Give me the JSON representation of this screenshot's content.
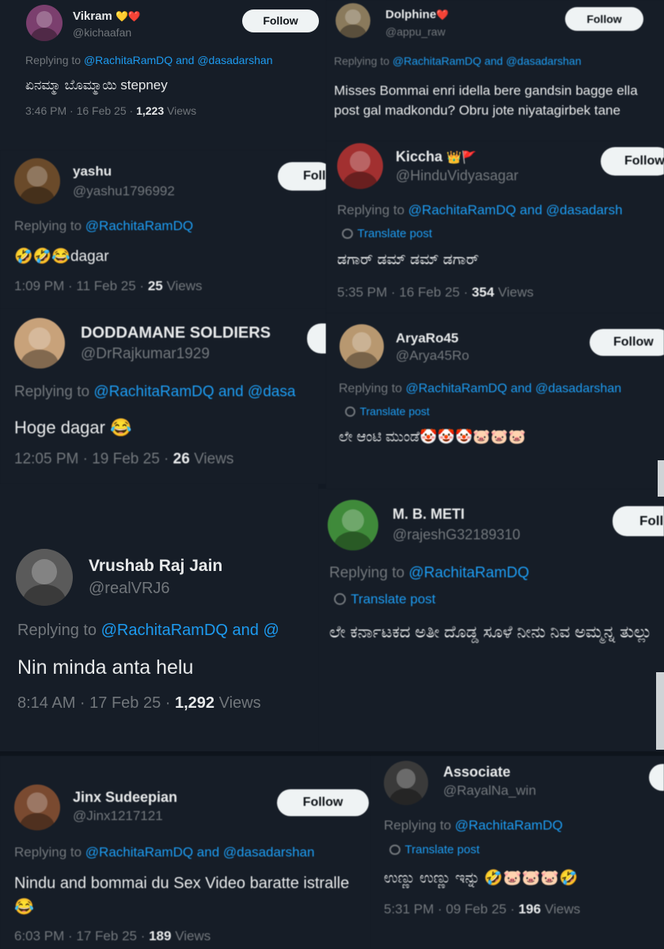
{
  "follow_label": "Follow",
  "translate_label": "Translate post",
  "replying_prefix": "Replying to",
  "tweets": [
    {
      "name": "Vikram",
      "badges": "💛❤️",
      "handle": "@kichaafan",
      "reply_mentions": "@RachitaRamDQ and @dasadarshan",
      "text": "ಏನಮ್ಮಾ ಬೊಮ್ಮಾಯಿ stepney",
      "time": "3:46 PM · 16 Feb 25 · ",
      "views_count": "1,223",
      "views_label": "Views",
      "avatar_color": "#7b3f6e"
    },
    {
      "name": "Dolphine",
      "badges": "❤️",
      "handle": "@appu_raw",
      "reply_mentions": "@RachitaRamDQ and @dasadarshan",
      "text": "Misses Bommai enri idella bere gandsin bagge ella post gal madkondu? Obru jote niyatagirbek tane",
      "avatar_color": "#8a7a5c"
    },
    {
      "name": "yashu",
      "badges": "",
      "handle": "@yashu1796992",
      "reply_mentions": "@RachitaRamDQ",
      "text": "🤣🤣😂dagar",
      "time": "1:09 PM · 11 Feb 25 · ",
      "views_count": "25",
      "views_label": "Views",
      "avatar_color": "#6a4a2a"
    },
    {
      "name": "Kiccha",
      "badges": "👑🚩",
      "handle": "@HinduVidyasagar",
      "reply_mentions": "@RachitaRamDQ and @dasadarsh",
      "text": "ಡಗಾರ್ ಡಮ್ ಡಮ್ ಡಗಾರ್",
      "time": "5:35 PM · 16 Feb 25 · ",
      "views_count": "354",
      "views_label": "Views",
      "avatar_color": "#a23030"
    },
    {
      "name": "DODDAMANE SOLDIERS",
      "badges": "",
      "handle": "@DrRajkumar1929",
      "reply_mentions": "@RachitaRamDQ and @dasa",
      "text": "Hoge dagar 😂",
      "time": "12:05 PM · 19 Feb 25 · ",
      "views_count": "26",
      "views_label": "Views",
      "avatar_color": "#c8a27a"
    },
    {
      "name": "AryaRo45",
      "badges": "",
      "handle": "@Arya45Ro",
      "reply_mentions": "@RachitaRamDQ and @dasadarshan",
      "text": "ಲೇ ಆಂಟಿ ಮುಂಡೆ🤡🤡🤡🐷🐷🐷",
      "avatar_color": "#b89870"
    },
    {
      "name": "M. B. METI",
      "badges": "",
      "handle": "@rajeshG32189310",
      "reply_mentions": "@RachitaRamDQ",
      "text": "ಲೇ ಕರ್ನಾಟಕದ ಅತೀ ದೊಡ್ಡ ಸೂಳೆ ನೀನು ನಿವ ಅಮ್ಮನ್ನ ತುಲ್ಲು",
      "avatar_color": "#3f8a3a"
    },
    {
      "name": "Vrushab Raj Jain",
      "badges": "",
      "handle": "@realVRJ6",
      "reply_mentions": "@RachitaRamDQ and @",
      "text": "Nin minda anta helu",
      "time": "8:14 AM · 17 Feb 25 · ",
      "views_count": "1,292",
      "views_label": "Views",
      "avatar_color": "#5a5a5a"
    },
    {
      "name": "Jinx Sudeepian",
      "badges": "",
      "handle": "@Jinx1217121",
      "reply_mentions": "@RachitaRamDQ and @dasadarshan",
      "text": "Nindu and bommai du Sex Video baratte istralle😂",
      "time": "6:03 PM · 17 Feb 25 · ",
      "views_count": "189",
      "views_label": "Views",
      "avatar_color": "#7a4a30"
    },
    {
      "name": "Associate",
      "badges": "",
      "handle": "@RayalNa_win",
      "reply_mentions": "@RachitaRamDQ",
      "text": "ಉಣ್ಣು ಉಣ್ಣು ಇನ್ನು 🤣🐷🐷🐷🤣",
      "time": "5:31 PM · 09 Feb 25 · ",
      "views_count": "196",
      "views_label": "Views",
      "avatar_color": "#3a3a3a"
    }
  ]
}
